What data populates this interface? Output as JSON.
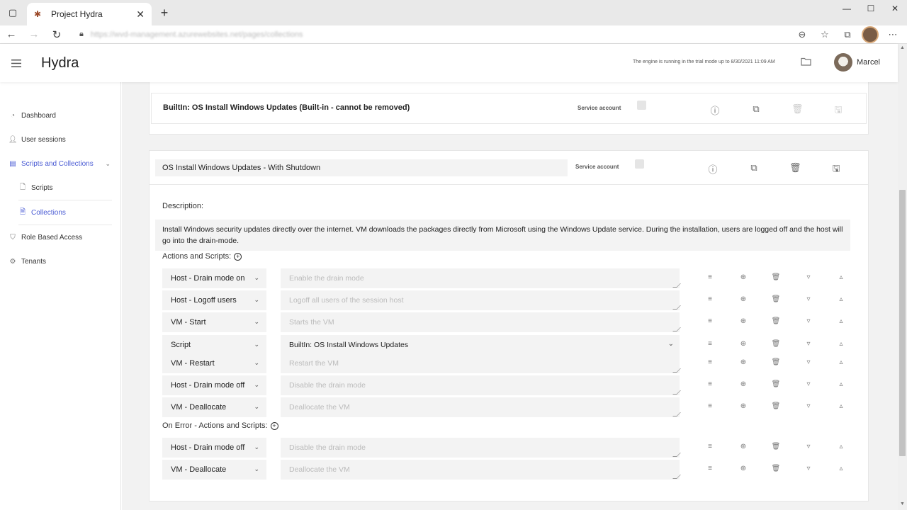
{
  "browser": {
    "tab_title": "Project Hydra",
    "url": "https://wvd-management.azurewebsites.net/pages/collections"
  },
  "header": {
    "app_title": "Hydra",
    "trial_text": "The engine is running in the trial mode up to 8/30/2021 11:09 AM",
    "user_name": "Marcel"
  },
  "sidebar": {
    "items": [
      {
        "label": "Dashboard",
        "icon": "chart-pie-icon"
      },
      {
        "label": "User sessions",
        "icon": "users-icon"
      },
      {
        "label": "Scripts and Collections",
        "icon": "archive-icon"
      },
      {
        "label": "Scripts",
        "icon": "file-icon"
      },
      {
        "label": "Collections",
        "icon": "file-code-icon"
      },
      {
        "label": "Role Based Access",
        "icon": "shield-icon"
      },
      {
        "label": "Tenants",
        "icon": "gear-icon"
      }
    ]
  },
  "builtin_card": {
    "title": "BuiltIn: OS Install Windows Updates (Built-in - cannot be removed)",
    "service_account_label": "Service account"
  },
  "collection_card": {
    "name": "OS Install Windows Updates - With Shutdown",
    "service_account_label": "Service account",
    "description_label": "Description:",
    "description": "Install Windows security updates directly over the internet. VM downloads the packages directly from Microsoft using the Windows Update service. During the installation, users are logged off and the host will go into the drain-mode.",
    "actions_label": "Actions and Scripts:",
    "on_error_label": "On Error - Actions and Scripts:",
    "actions": [
      {
        "action": "Host - Drain mode on",
        "placeholder": "Enable the drain mode"
      },
      {
        "action": "Host - Logoff users",
        "placeholder": "Logoff all users of the session host"
      },
      {
        "action": "VM - Start",
        "placeholder": "Starts the VM"
      },
      {
        "action": "Script",
        "value": "BuiltIn: OS Install Windows Updates"
      },
      {
        "action": "VM - Restart",
        "placeholder": "Restart the VM"
      },
      {
        "action": "Host - Drain mode off",
        "placeholder": "Disable the drain mode"
      },
      {
        "action": "VM - Deallocate",
        "placeholder": "Deallocate the VM"
      }
    ],
    "on_error_actions": [
      {
        "action": "Host - Drain mode off",
        "placeholder": "Disable the drain mode"
      },
      {
        "action": "VM - Deallocate",
        "placeholder": "Deallocate the VM"
      }
    ]
  }
}
